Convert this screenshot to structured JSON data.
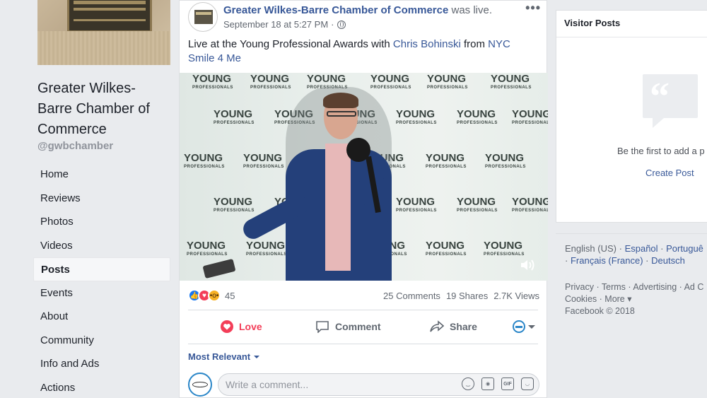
{
  "page": {
    "name": "Greater Wilkes-Barre Chamber of Commerce",
    "handle": "@gwbchamber"
  },
  "nav": {
    "items": [
      {
        "label": "Home"
      },
      {
        "label": "Reviews"
      },
      {
        "label": "Photos"
      },
      {
        "label": "Videos"
      },
      {
        "label": "Posts"
      },
      {
        "label": "Events"
      },
      {
        "label": "About"
      },
      {
        "label": "Community"
      },
      {
        "label": "Info and Ads"
      },
      {
        "label": "Actions"
      }
    ],
    "active": "Posts"
  },
  "post": {
    "author": "Greater Wilkes-Barre Chamber of Commerce",
    "action": "was live.",
    "timestamp": "September 18 at 5:27 PM",
    "dot": "·",
    "more": "•••",
    "text_prefix": "Live at the Young Professional Awards with ",
    "mention_1": "Chris Bohinski",
    "text_mid": " from ",
    "mention_2": "NYC Smile 4 Me",
    "video": {
      "watermark_word": "YOUNG",
      "watermark_sub": "PROFESSIONALS"
    },
    "reaction_count": "45",
    "comments": "25 Comments",
    "shares": "19 Shares",
    "views": "2.7K Views",
    "actions": {
      "love": "Love",
      "comment": "Comment",
      "share": "Share"
    },
    "sort_label": "Most Relevant",
    "comment_placeholder": "Write a comment...",
    "comment_icons": {
      "gif": "GIF"
    }
  },
  "visitor_posts": {
    "title": "Visitor Posts",
    "empty_text": "Be the first to add a p",
    "create_label": "Create Post"
  },
  "languages": {
    "current": "English (US)",
    "options": [
      "Español",
      "Portuguê",
      "Français (France)",
      "Deutsch"
    ],
    "separator": "·"
  },
  "footer": {
    "links_row1": [
      "Privacy",
      "Terms",
      "Advertising",
      "Ad C"
    ],
    "links_row2_a": "Cookies",
    "links_row2_b": "More",
    "copyright": "Facebook © 2018"
  },
  "colors": {
    "link": "#385898",
    "love": "#f33e58",
    "background": "#e9ebee"
  }
}
